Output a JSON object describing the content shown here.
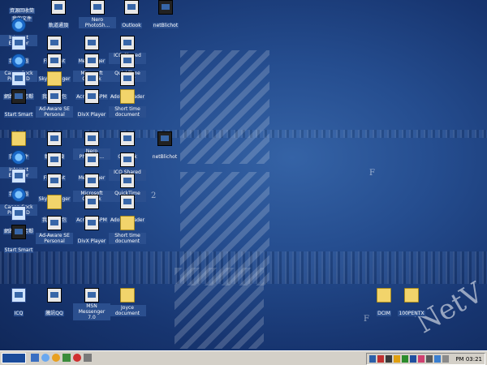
{
  "desktop": {
    "icons_top": [
      {
        "label": "資源回收筒",
        "kind": "folder"
      },
      {
        "label": "我的文件",
        "kind": "folder"
      },
      {
        "label": "軌道通頂",
        "kind": "app"
      },
      {
        "label": "Nero PhotoSh...",
        "kind": "app"
      },
      {
        "label": "Outlook",
        "kind": "app"
      },
      {
        "label": "netBlichot",
        "kind": "app"
      }
    ],
    "icons_col1": [
      "Internet Explorer",
      "我的電腦",
      "Canon Sock Print ATD",
      "網路上的芳鄰",
      "Start Smart"
    ],
    "icons_col2": [
      "FlashGet",
      "Sky Manager",
      "我的公事包",
      "Ad-Aware SE Personal"
    ],
    "icons_col3": [
      "Messenger",
      "Microsoft Outlook",
      "Acrobat 5PM",
      "DivX Player"
    ],
    "icons_col4": [
      "ICQ Shared Files",
      "QuickTime Player",
      "Adobe Reader",
      "Short time document"
    ],
    "icons_mid_col1": [
      "我的文件",
      "Internet Explorer",
      "我的電腦",
      "Canon Sock Print ATD",
      "網路上的芳鄰",
      "Start Smart"
    ],
    "icons_mid_col2": [
      "軌道通頂",
      "FlashGet",
      "Sky Manager",
      "我的公事包",
      "Ad-Aware SE Personal"
    ],
    "icons_mid_col3": [
      "Nero PhotoSh...",
      "Messenger",
      "Microsoft Outlook",
      "Acrobat 5PM",
      "DivX Player"
    ],
    "icons_mid_col4": [
      "Outlook",
      "ICQ Shared Files",
      "QuickTime Player",
      "Adobe Reader",
      "Short time document"
    ],
    "icons_mid_col5": [
      "netBlichot"
    ],
    "icons_bottom": [
      {
        "label": "ICQ",
        "kind": "blue"
      },
      {
        "label": "騰訊QQ",
        "kind": "app"
      },
      {
        "label": "MSN Messenger 7.0",
        "kind": "app"
      },
      {
        "label": "Joyce document",
        "kind": "folder"
      },
      {
        "label": "DCIM",
        "kind": "folder"
      },
      {
        "label": "100PENTX",
        "kind": "folder"
      }
    ],
    "watermark_text": "NetV",
    "stray_glyphs": [
      "F",
      "2",
      "F",
      "F"
    ]
  },
  "taskbar": {
    "clock": "PM 03:21"
  },
  "colors": {
    "desktop": "#254d8f",
    "taskbar": "#d4d0c8",
    "start": "#1a4b9a"
  }
}
